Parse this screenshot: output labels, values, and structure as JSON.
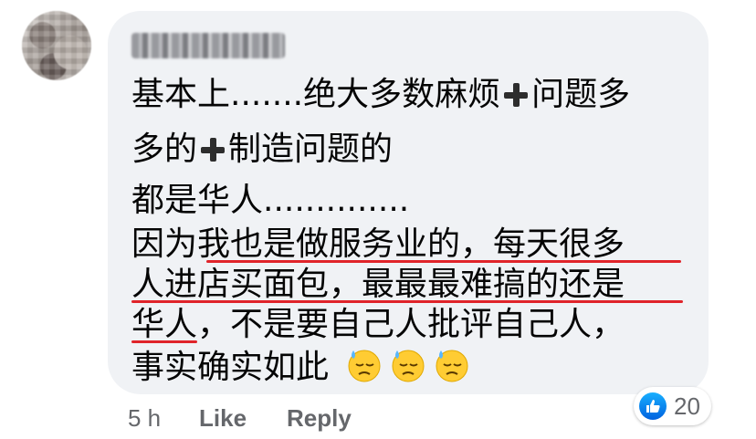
{
  "comment": {
    "author": "Mang Mang",
    "lines": [
      "基本上.......绝大多数麻烦",
      "问题多",
      "多的",
      "制造问题的",
      "都是华人..............",
      "因为我也是做服务业的，每天很多",
      "人进店买面包，最最最难搞的还是",
      "华人，不是要自己人批评自己人，",
      "事实确实如此"
    ],
    "icons": {
      "plus": "heavy-plus-icon",
      "emoji": "downcast-face-with-sweat-icon"
    },
    "underline_color": "#e0242a"
  },
  "meta": {
    "time": "5 h",
    "like": "Like",
    "reply": "Reply"
  },
  "reactions": {
    "type": "like",
    "count": "20",
    "color": "#1877f2"
  }
}
